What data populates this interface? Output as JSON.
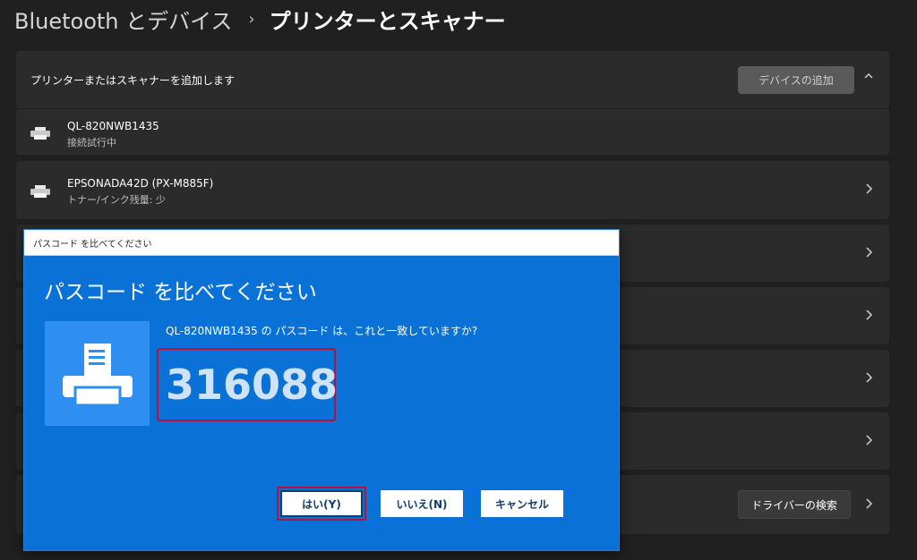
{
  "breadcrumb": {
    "parent": "Bluetooth とデバイス",
    "separator": "›",
    "current": "プリンターとスキャナー"
  },
  "add_card": {
    "title": "プリンターまたはスキャナーを追加します",
    "add_button": "デバイスの追加",
    "collapse_icon": "chevron-up-icon"
  },
  "found_device": {
    "name": "QL-820NWB1435",
    "status": "接続試行中"
  },
  "printers": [
    {
      "name": "EPSONADA42D (PX-M885F)",
      "status": "トナー/インク残量: 少"
    }
  ],
  "driver_card": {
    "button": "ドライバーの検索"
  },
  "dialog": {
    "title": "パスコード を比べてください",
    "heading": "パスコード を比べてください",
    "message": "QL-820NWB1435 の パスコード は、これと一致していますか?",
    "passcode": "316088",
    "yes_button": "はい(Y)",
    "no_button": "いいえ(N)",
    "cancel_button": "キャンセル"
  },
  "colors": {
    "background": "#202020",
    "card": "#2b2b2b",
    "dialog_blue": "#0a72d6",
    "highlight_red": "#b3123a"
  }
}
